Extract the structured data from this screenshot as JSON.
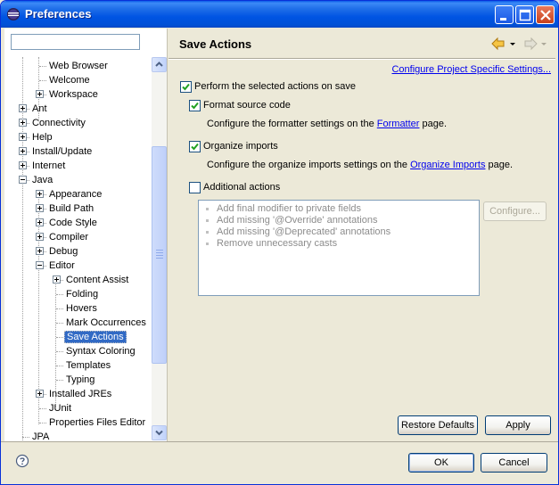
{
  "window": {
    "title": "Preferences"
  },
  "filter": {
    "value": "",
    "placeholder": ""
  },
  "tree": {
    "items": [
      {
        "label": "Web Browser",
        "level": 2,
        "expander": "none"
      },
      {
        "label": "Welcome",
        "level": 2,
        "expander": "none"
      },
      {
        "label": "Workspace",
        "level": 2,
        "expander": "plus"
      },
      {
        "label": "Ant",
        "level": 1,
        "expander": "plus"
      },
      {
        "label": "Connectivity",
        "level": 1,
        "expander": "plus"
      },
      {
        "label": "Help",
        "level": 1,
        "expander": "plus"
      },
      {
        "label": "Install/Update",
        "level": 1,
        "expander": "plus"
      },
      {
        "label": "Internet",
        "level": 1,
        "expander": "plus"
      },
      {
        "label": "Java",
        "level": 1,
        "expander": "minus"
      },
      {
        "label": "Appearance",
        "level": 2,
        "expander": "plus"
      },
      {
        "label": "Build Path",
        "level": 2,
        "expander": "plus"
      },
      {
        "label": "Code Style",
        "level": 2,
        "expander": "plus"
      },
      {
        "label": "Compiler",
        "level": 2,
        "expander": "plus"
      },
      {
        "label": "Debug",
        "level": 2,
        "expander": "plus"
      },
      {
        "label": "Editor",
        "level": 2,
        "expander": "minus"
      },
      {
        "label": "Content Assist",
        "level": 3,
        "expander": "plus"
      },
      {
        "label": "Folding",
        "level": 3,
        "expander": "none"
      },
      {
        "label": "Hovers",
        "level": 3,
        "expander": "none"
      },
      {
        "label": "Mark Occurrences",
        "level": 3,
        "expander": "none"
      },
      {
        "label": "Save Actions",
        "level": 3,
        "expander": "none",
        "selected": true
      },
      {
        "label": "Syntax Coloring",
        "level": 3,
        "expander": "none"
      },
      {
        "label": "Templates",
        "level": 3,
        "expander": "none"
      },
      {
        "label": "Typing",
        "level": 3,
        "expander": "none"
      },
      {
        "label": "Installed JREs",
        "level": 2,
        "expander": "plus"
      },
      {
        "label": "JUnit",
        "level": 2,
        "expander": "none"
      },
      {
        "label": "Properties Files Editor",
        "level": 2,
        "expander": "none"
      },
      {
        "label": "JPA",
        "level": 1,
        "expander": "none"
      }
    ]
  },
  "page": {
    "title": "Save Actions",
    "configure_project_link": "Configure Project Specific Settings...",
    "perform": {
      "label": "Perform the selected actions on save",
      "checked": true
    },
    "format": {
      "label": "Format source code",
      "checked": true,
      "desc_prefix": "Configure the formatter settings on the ",
      "desc_link": "Formatter",
      "desc_suffix": " page."
    },
    "organize": {
      "label": "Organize imports",
      "checked": true,
      "desc_prefix": "Configure the organize imports settings on the ",
      "desc_link": "Organize Imports",
      "desc_suffix": " page."
    },
    "additional": {
      "label": "Additional actions",
      "checked": false
    },
    "actions_list": [
      "Add final modifier to private fields",
      "Add missing '@Override' annotations",
      "Add missing '@Deprecated' annotations",
      "Remove unnecessary casts"
    ],
    "configure_button": "Configure...",
    "restore_defaults_button": "Restore Defaults",
    "apply_button": "Apply"
  },
  "footer": {
    "ok_button": "OK",
    "cancel_button": "Cancel"
  },
  "colors": {
    "title_bar": "#0054e3",
    "selection": "#316ac5",
    "link": "#0000ee",
    "dialog_bg": "#ece9d8"
  }
}
